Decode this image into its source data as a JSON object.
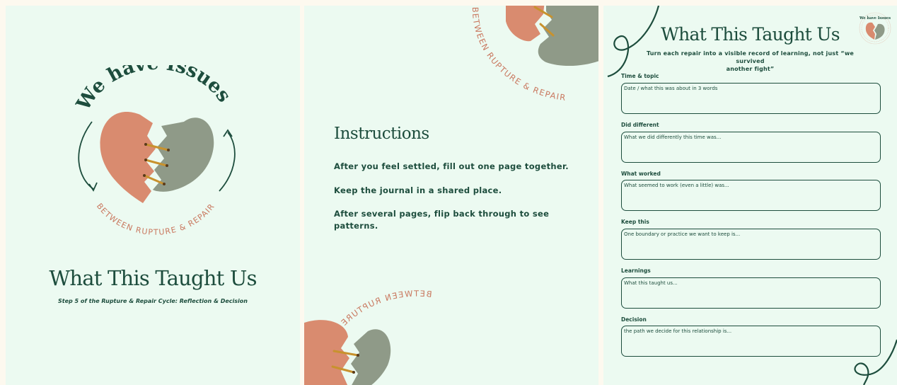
{
  "cover": {
    "brand": "We have Issues",
    "tagline": "BETWEEN RUPTURE & REPAIR",
    "title": "What This Taught Us",
    "subtitle": "Step 5 of the Rupture & Repair Cycle: Reflection & Decision"
  },
  "instructions_page": {
    "top_arc_text": "BETWEEN RUPTURE & REPAIR",
    "bottom_arc_text": "BETWEEN RUPTURE & REPAIR",
    "heading": "Instructions",
    "lines": [
      "After you feel settled, fill out one page together.",
      "Keep the journal in a shared place.",
      "After several pages, flip back through to see",
      "patterns."
    ]
  },
  "worksheet": {
    "badge_text": "We have Issues",
    "title": "What This Taught Us",
    "subtitle_line1": "Turn each repair into a visible record of learning, not just “we survived",
    "subtitle_line2": "another fight”",
    "fields": [
      {
        "label": "Time & topic",
        "placeholder": "Date / what this was about in 3 words"
      },
      {
        "label": "Did different",
        "placeholder": "What we did differently this time was..."
      },
      {
        "label": "What worked",
        "placeholder": "What seemed to work (even a little) was..."
      },
      {
        "label": "Keep this",
        "placeholder": "One boundary or practice we want to keep is..."
      },
      {
        "label": "Learnings",
        "placeholder": "What this taught us..."
      },
      {
        "label": "Decision",
        "placeholder": "the path we decide for this relationship is..."
      }
    ]
  },
  "colors": {
    "page_bg": "#ecfaf1",
    "outer_bg": "#fdf9ef",
    "dark_green": "#1d4d3d",
    "terracotta": "#d98b6f",
    "sage": "#8f9a88",
    "gold": "#c8922e"
  }
}
